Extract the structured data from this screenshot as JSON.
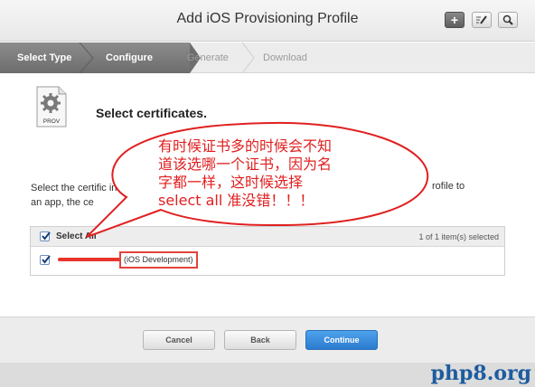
{
  "header": {
    "title": "Add iOS Provisioning Profile",
    "buttons": [
      "add-icon",
      "edit-icon",
      "search-icon"
    ]
  },
  "steps": [
    {
      "label": "Select Type",
      "state": "done"
    },
    {
      "label": "Configure",
      "state": "current"
    },
    {
      "label": "Generate",
      "state": "upcoming"
    },
    {
      "label": "Download",
      "state": "upcoming"
    }
  ],
  "icon": {
    "label": "PROV"
  },
  "section": {
    "title": "Select certificates.",
    "description_left": "Select the certific install an app, the ce",
    "description_right": "rofile to"
  },
  "list": {
    "select_all": "Select All",
    "count": "1 of 1 item(s) selected",
    "rows": [
      {
        "checked": true,
        "label": "(iOS Development)"
      }
    ]
  },
  "footer": {
    "cancel": "Cancel",
    "back": "Back",
    "continue": "Continue"
  },
  "annotation": {
    "line1": "有时候证书多的时候会不知",
    "line2": "道该选哪一个证书，因为名",
    "line3": "字都一样，这时候选择",
    "line4": "select all 准没错！！！",
    "color": "#e02020"
  },
  "watermark": "php8.org"
}
